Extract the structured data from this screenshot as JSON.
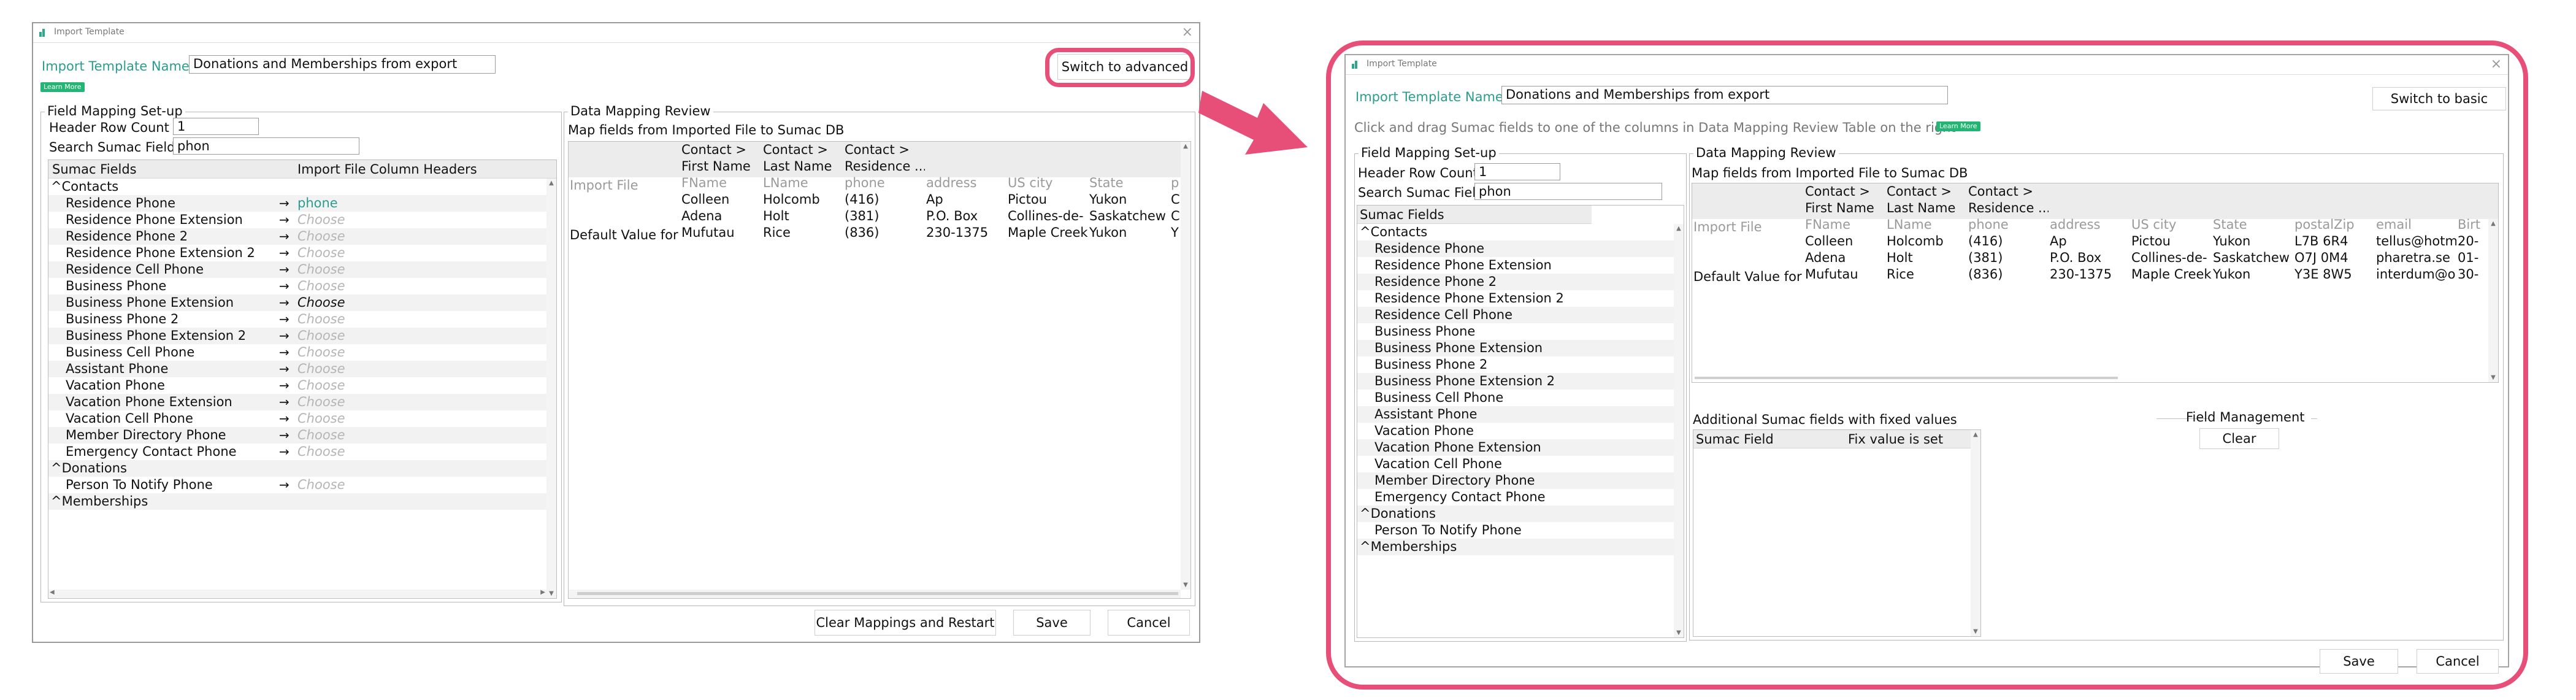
{
  "colors": {
    "accent": "#2a9d8f",
    "highlight": "#e84f78",
    "badge": "#22b573"
  },
  "before": {
    "window_title": "Import Template",
    "template_name_label": "Import Template Name",
    "template_name_value": "Donations and Memberships from export",
    "learn_more": "Learn More",
    "switch_button": "Switch to advanced",
    "setup": {
      "legend": "Field Mapping Set-up",
      "header_row_label": "Header Row Count",
      "header_row_value": "1",
      "search_label": "Search Sumac Field",
      "search_value": "phon",
      "col_fields": "Sumac Fields",
      "col_headers": "Import File Column Headers",
      "rows": [
        {
          "name": "^Contacts",
          "group": true
        },
        {
          "name": "Residence Phone",
          "arrow": "→",
          "choose": "phone"
        },
        {
          "name": "Residence Phone Extension",
          "arrow": "→",
          "choose": "Choose"
        },
        {
          "name": "Residence Phone 2",
          "arrow": "→",
          "choose": "Choose"
        },
        {
          "name": "Residence Phone Extension 2",
          "arrow": "→",
          "choose": "Choose"
        },
        {
          "name": "Residence Cell Phone",
          "arrow": "→",
          "choose": "Choose"
        },
        {
          "name": "Business Phone",
          "arrow": "→",
          "choose": "Choose"
        },
        {
          "name": "Business Phone Extension",
          "arrow": "→",
          "choose": "Choose"
        },
        {
          "name": "Business Phone 2",
          "arrow": "→",
          "choose": "Choose"
        },
        {
          "name": "Business Phone Extension 2",
          "arrow": "→",
          "choose": "Choose"
        },
        {
          "name": "Business Cell Phone",
          "arrow": "→",
          "choose": "Choose"
        },
        {
          "name": "Assistant Phone",
          "arrow": "→",
          "choose": "Choose"
        },
        {
          "name": "Vacation Phone",
          "arrow": "→",
          "choose": "Choose"
        },
        {
          "name": "Vacation Phone Extension",
          "arrow": "→",
          "choose": "Choose"
        },
        {
          "name": "Vacation Cell Phone",
          "arrow": "→",
          "choose": "Choose"
        },
        {
          "name": "Member Directory Phone",
          "arrow": "→",
          "choose": "Choose"
        },
        {
          "name": "Emergency Contact Phone",
          "arrow": "→",
          "choose": "Choose"
        },
        {
          "name": "^Donations",
          "group": true
        },
        {
          "name": "Person To Notify Phone",
          "arrow": "→",
          "choose": "Choose"
        },
        {
          "name": "^Memberships",
          "group": true
        }
      ]
    },
    "review": {
      "legend": "Data Mapping Review",
      "subtitle": "Map fields from Imported File to Sumac DB",
      "row_import": "Import File",
      "row_default": "Default Value for",
      "columns": [
        {
          "h1": "Contact >",
          "h2": "First Name",
          "f": "FName",
          "d": [
            "Colleen",
            "Adena",
            "Mufutau"
          ]
        },
        {
          "h1": "Contact >",
          "h2": "Last Name",
          "f": "LName",
          "d": [
            "Holcomb",
            "Holt",
            "Rice"
          ]
        },
        {
          "h1": "Contact >",
          "h2": "Residence ...",
          "f": "phone",
          "d": [
            "(416)",
            "(381)",
            "(836)"
          ]
        },
        {
          "h1": "",
          "h2": "",
          "f": "address",
          "d": [
            "Ap",
            "P.O. Box",
            "230-1375"
          ]
        },
        {
          "h1": "",
          "h2": "",
          "f": "US city",
          "d": [
            "Pictou",
            "Collines-de-",
            "Maple Creek"
          ]
        },
        {
          "h1": "",
          "h2": "",
          "f": "State",
          "d": [
            "Yukon",
            "Saskatchew",
            "Yukon"
          ]
        },
        {
          "h1": "",
          "h2": "",
          "f": "p",
          "d": [
            "C",
            "C",
            "Y"
          ]
        }
      ]
    },
    "btn_clear": "Clear Mappings and Restart",
    "btn_save": "Save",
    "btn_cancel": "Cancel"
  },
  "after": {
    "window_title": "Import Template",
    "template_name_label": "Import Template Name",
    "template_name_value": "Donations and Memberships from export",
    "switch_button": "Switch to basic",
    "instruction": "Click and drag Sumac fields to one of the columns in Data Mapping Review Table on the right",
    "learn_more": "Learn More",
    "setup": {
      "legend": "Field Mapping Set-up",
      "header_row_label": "Header Row Count",
      "header_row_value": "1",
      "search_label": "Search Sumac Field",
      "search_value": "phon",
      "col_fields": "Sumac Fields",
      "rows": [
        {
          "name": "^Contacts",
          "group": true
        },
        {
          "name": "Residence Phone"
        },
        {
          "name": "Residence Phone Extension"
        },
        {
          "name": "Residence Phone 2"
        },
        {
          "name": "Residence Phone Extension 2"
        },
        {
          "name": "Residence Cell Phone"
        },
        {
          "name": "Business Phone"
        },
        {
          "name": "Business Phone Extension"
        },
        {
          "name": "Business Phone 2"
        },
        {
          "name": "Business Phone Extension 2"
        },
        {
          "name": "Business Cell Phone"
        },
        {
          "name": "Assistant Phone"
        },
        {
          "name": "Vacation Phone"
        },
        {
          "name": "Vacation Phone Extension"
        },
        {
          "name": "Vacation Cell Phone"
        },
        {
          "name": "Member Directory Phone"
        },
        {
          "name": "Emergency Contact Phone"
        },
        {
          "name": "^Donations",
          "group": true
        },
        {
          "name": "Person To Notify Phone"
        },
        {
          "name": "^Memberships",
          "group": true
        }
      ]
    },
    "review": {
      "legend": "Data Mapping Review",
      "subtitle": "Map fields from Imported File to Sumac DB",
      "row_import": "Import File",
      "row_default": "Default Value for",
      "columns": [
        {
          "h1": "Contact >",
          "h2": "First Name",
          "f": "FName",
          "d": [
            "Colleen",
            "Adena",
            "Mufutau"
          ]
        },
        {
          "h1": "Contact >",
          "h2": "Last Name",
          "f": "LName",
          "d": [
            "Holcomb",
            "Holt",
            "Rice"
          ]
        },
        {
          "h1": "Contact >",
          "h2": "Residence ...",
          "f": "phone",
          "d": [
            "(416)",
            "(381)",
            "(836)"
          ]
        },
        {
          "h1": "",
          "h2": "",
          "f": "address",
          "d": [
            "Ap",
            "P.O. Box",
            "230-1375"
          ]
        },
        {
          "h1": "",
          "h2": "",
          "f": "US city",
          "d": [
            "Pictou",
            "Collines-de-",
            "Maple Creek"
          ]
        },
        {
          "h1": "",
          "h2": "",
          "f": "State",
          "d": [
            "Yukon",
            "Saskatchew",
            "Yukon"
          ]
        },
        {
          "h1": "",
          "h2": "",
          "f": "postalZip",
          "d": [
            "L7B 6R4",
            "O7J 0M4",
            "Y3E 8W5"
          ]
        },
        {
          "h1": "",
          "h2": "",
          "f": "email",
          "d": [
            "tellus@hotm",
            "pharetra.se",
            "interdum@o"
          ]
        },
        {
          "h1": "",
          "h2": "",
          "f": "Birt",
          "d": [
            "20-",
            "01-",
            "30-"
          ]
        }
      ]
    },
    "additional": {
      "title": "Additional Sumac fields with fixed values",
      "col_field": "Sumac Field",
      "col_fix": "Fix value is set"
    },
    "field_management": "Field Management",
    "btn_clear": "Clear",
    "btn_save": "Save",
    "btn_cancel": "Cancel"
  }
}
